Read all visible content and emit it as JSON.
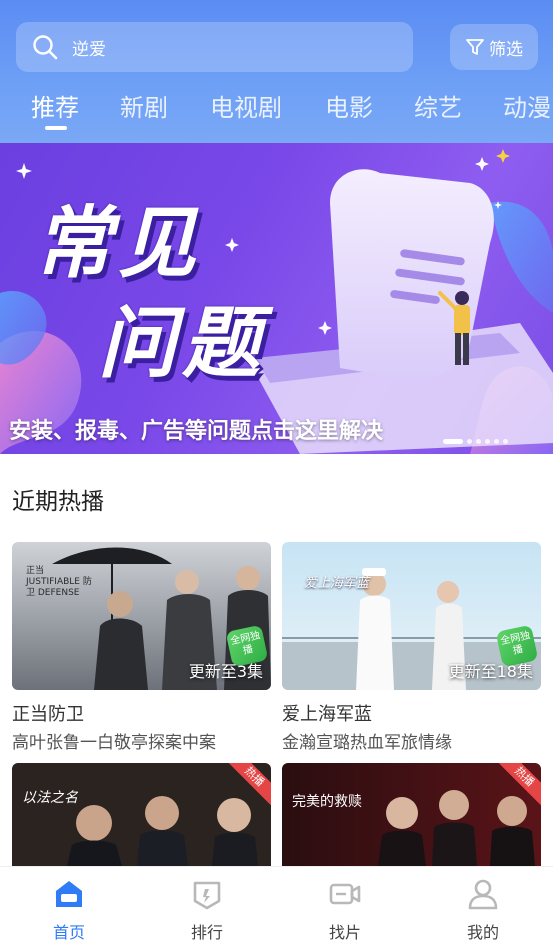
{
  "search": {
    "placeholder": "逆爱",
    "filter_label": "筛选"
  },
  "tabs": [
    {
      "label": "推荐",
      "active": true
    },
    {
      "label": "新剧",
      "active": false
    },
    {
      "label": "电视剧",
      "active": false
    },
    {
      "label": "电影",
      "active": false
    },
    {
      "label": "综艺",
      "active": false
    },
    {
      "label": "动漫",
      "active": false
    }
  ],
  "banner": {
    "title_line1": "常见",
    "title_line2": "问题",
    "caption": "安装、报毒、广告等问题点击这里解决",
    "slide_count": 6,
    "active_slide": 1
  },
  "section": {
    "title": "近期热播"
  },
  "cards": [
    {
      "title": "正当防卫",
      "desc": "高叶张鲁一白敬亭探案中案",
      "update": "更新至3集",
      "poster_text": "正当 JUSTIFIABLE 防卫 DEFENSE",
      "badge": "全网独播",
      "hot": ""
    },
    {
      "title": "爱上海军蓝",
      "desc": "金瀚宣璐热血军旅情缘",
      "update": "更新至18集",
      "poster_text": "爱上海军蓝",
      "badge": "全网独播",
      "hot": ""
    },
    {
      "title": "",
      "desc": "",
      "update": "",
      "poster_text": "以法之名",
      "badge": "",
      "hot": "热播"
    },
    {
      "title": "",
      "desc": "",
      "update": "",
      "poster_text": "完美的救赎",
      "badge": "",
      "hot": "热播"
    }
  ],
  "tabbar": [
    {
      "label": "首页",
      "icon": "home-icon",
      "active": true
    },
    {
      "label": "排行",
      "icon": "ranking-icon",
      "active": false
    },
    {
      "label": "找片",
      "icon": "video-camera-icon",
      "active": false
    },
    {
      "label": "我的",
      "icon": "user-icon",
      "active": false
    }
  ],
  "colors": {
    "accent": "#2f7cf6",
    "header": "#5b8cf3",
    "banner": "#7a48e8",
    "hot_tag": "#e64545"
  }
}
